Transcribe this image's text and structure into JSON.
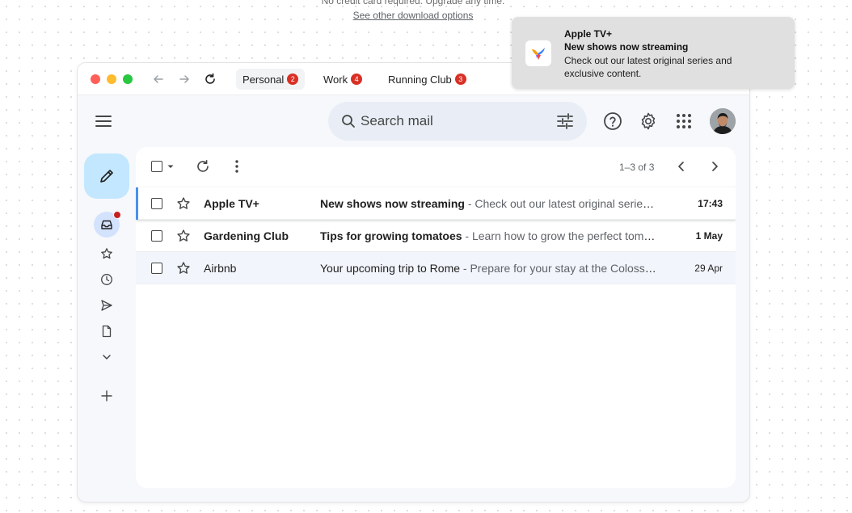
{
  "page": {
    "top_note": "No credit card required. Upgrade any time.",
    "other_options_link": "See other download options"
  },
  "browser": {
    "tabs": [
      {
        "label": "Personal",
        "badge": "2"
      },
      {
        "label": "Work",
        "badge": "4"
      },
      {
        "label": "Running Club",
        "badge": "3"
      }
    ]
  },
  "header": {
    "search_placeholder": "Search mail"
  },
  "toolbar": {
    "pagination": "1–3 of 3"
  },
  "emails": [
    {
      "sender": "Apple TV+",
      "subject": "New shows now streaming",
      "snippet": " - Check out our latest original series and exclusive content.",
      "time": "17:43",
      "unread": true
    },
    {
      "sender": "Gardening Club",
      "subject": "Tips for growing tomatoes",
      "snippet": " - Learn how to grow the perfect tomatoes this season.",
      "time": "1 May",
      "unread": true
    },
    {
      "sender": "Airbnb",
      "subject": "Your upcoming trip to Rome",
      "snippet": " - Prepare for your stay at the Colosseum view apartment.",
      "time": "29 Apr",
      "unread": false
    }
  ],
  "notification": {
    "app": "Apple TV+",
    "title": "New shows now streaming",
    "body": "Check out our latest original series and exclusive content."
  },
  "colors": {
    "accent": "#4a90f0",
    "badge": "#d93025",
    "compose": "#c2e7ff"
  }
}
